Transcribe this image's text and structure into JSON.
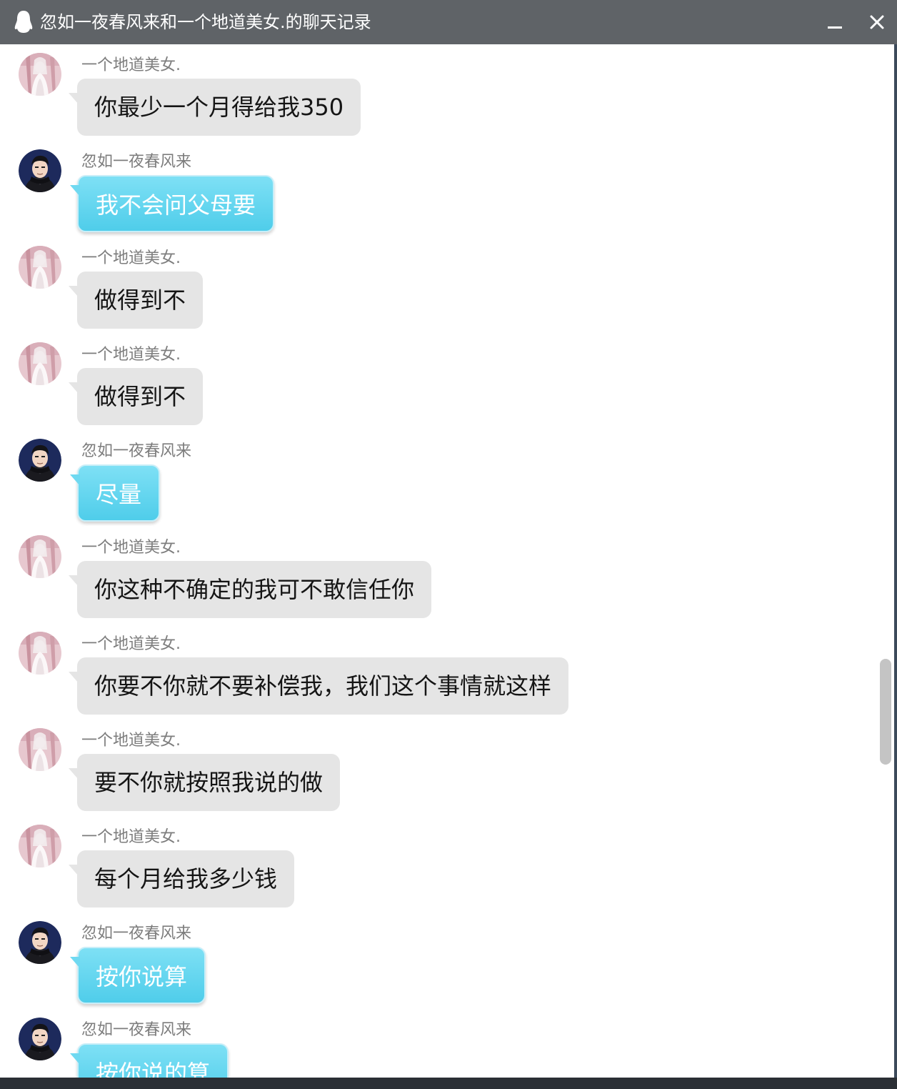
{
  "window": {
    "title": "忽如一夜春风来和一个地道美女.的聊天记录",
    "title_icon": "qq-penguin-icon"
  },
  "colors": {
    "titlebar": "#5f6367",
    "her_bubble": "#e5e5e5",
    "my_bubble": "#5fd3ee",
    "sender_text": "#7d7d7d"
  },
  "messages": [
    {
      "sender": "一个地道美女.",
      "side": "her",
      "text": "你最少一个月得给我350"
    },
    {
      "sender": "忽如一夜春风来",
      "side": "me",
      "text": "我不会问父母要"
    },
    {
      "sender": "一个地道美女.",
      "side": "her",
      "text": "做得到不"
    },
    {
      "sender": "一个地道美女.",
      "side": "her",
      "text": "做得到不"
    },
    {
      "sender": "忽如一夜春风来",
      "side": "me",
      "text": "尽量"
    },
    {
      "sender": "一个地道美女.",
      "side": "her",
      "text": "你这种不确定的我可不敢信任你"
    },
    {
      "sender": "一个地道美女.",
      "side": "her",
      "text": "你要不你就不要补偿我，我们这个事情就这样"
    },
    {
      "sender": "一个地道美女.",
      "side": "her",
      "text": "要不你就按照我说的做"
    },
    {
      "sender": "一个地道美女.",
      "side": "her",
      "text": "每个月给我多少钱"
    },
    {
      "sender": "忽如一夜春风来",
      "side": "me",
      "text": "按你说算"
    },
    {
      "sender": "忽如一夜春风来",
      "side": "me",
      "text": "按你说的算"
    }
  ]
}
